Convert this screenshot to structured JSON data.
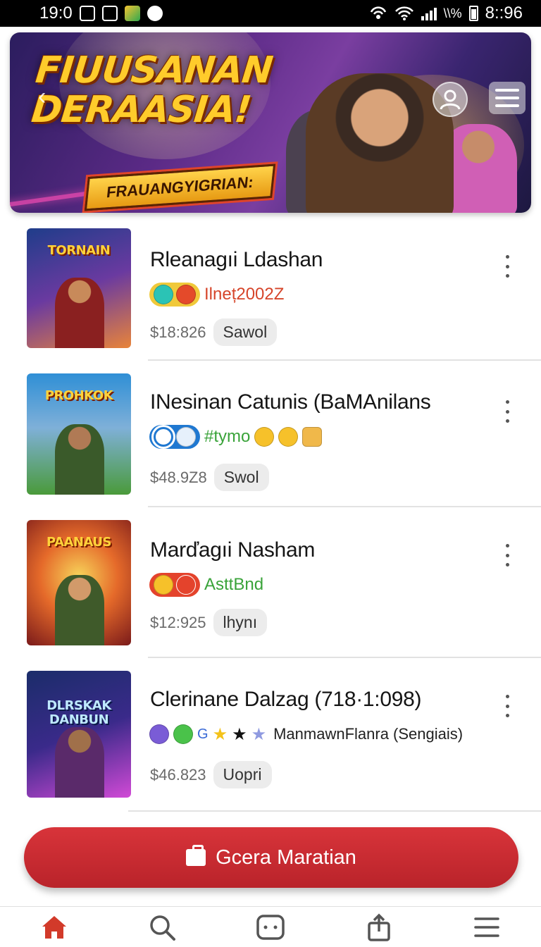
{
  "status_bar": {
    "time_left": "19:0",
    "time_right": "8::96",
    "battery_text": "\\\\%"
  },
  "hero": {
    "title_line1": "FIUUSANAN",
    "title_line2": "DERAASIA!",
    "subtitle": "FRAUANGYIGRIAN:",
    "back_glyph": "‹",
    "profile_icon": "user-icon",
    "menu_icon": "hamburger-icon"
  },
  "items": [
    {
      "thumb_label": "TORNAIN",
      "thumb_colors": [
        "#1f3d8a",
        "#e8843a"
      ],
      "title": "Rleanagıi Ldashan",
      "icons": [
        "#2bc3b5",
        "#e44a2a"
      ],
      "icon_pill_bg": "#f0c93a",
      "tag": "Ilneț2002Z",
      "tag_color": "#d6452a",
      "price": "$18:826",
      "chip": "Sawol"
    },
    {
      "thumb_label": "PROHKOK",
      "thumb_colors": [
        "#2f8fd6",
        "#4a9a3a"
      ],
      "title": "INesinan Catunis (BaMAnilans",
      "icons": [
        "#ffffff",
        "#4aa3e8"
      ],
      "icon_pill_bg": "#1f78d1",
      "tag": "#tymo",
      "tag_color": "#3aa33a",
      "emojis": [
        "#f6c12a",
        "#f6c12a",
        "#f0b84a"
      ],
      "price": "$48.9Z8",
      "chip": "Swol"
    },
    {
      "thumb_label": "PAANAUS",
      "thumb_colors": [
        "#c4362a",
        "#f3b23a"
      ],
      "title": "Marďagıi Nasham",
      "icons": [
        "#f6c12a",
        "#e44a2a"
      ],
      "icon_pill_bg": "#e4432c",
      "tag": "AsttBnd",
      "tag_color": "#3aa33a",
      "price": "$12:925",
      "chip": "lhynı"
    },
    {
      "thumb_label": "DLRSKAK DANBUN",
      "thumb_colors": [
        "#1b2d6a",
        "#d14ad6"
      ],
      "title": "Clerinane Dalzag  (718·1:098)",
      "icons": [
        "#7a5cd6",
        "#4ac24a"
      ],
      "icon_pill_bg": "transparent",
      "tag": "G",
      "tag_color": "#3a6ad6",
      "stars": [
        "★",
        "★",
        "★"
      ],
      "star_colors": [
        "#f4c21a",
        "#111111",
        "#8f9ae0"
      ],
      "extra": "ManmawnFlanra (Sengiais)",
      "price": "$46.823",
      "chip": "Uopri"
    }
  ],
  "cta": {
    "label": "Gcera Maratian",
    "icon": "briefcase-icon"
  },
  "bottom_nav": [
    {
      "name": "home",
      "icon": "home-icon",
      "active": true
    },
    {
      "name": "search",
      "icon": "search-icon",
      "active": false
    },
    {
      "name": "games",
      "icon": "gamepad-icon",
      "active": false
    },
    {
      "name": "share",
      "icon": "share-icon",
      "active": false
    },
    {
      "name": "menu",
      "icon": "menu-icon",
      "active": false
    }
  ],
  "colors": {
    "accent": "#c8282f",
    "nav_active": "#d23a2a",
    "nav_inactive": "#6a6a6a"
  }
}
